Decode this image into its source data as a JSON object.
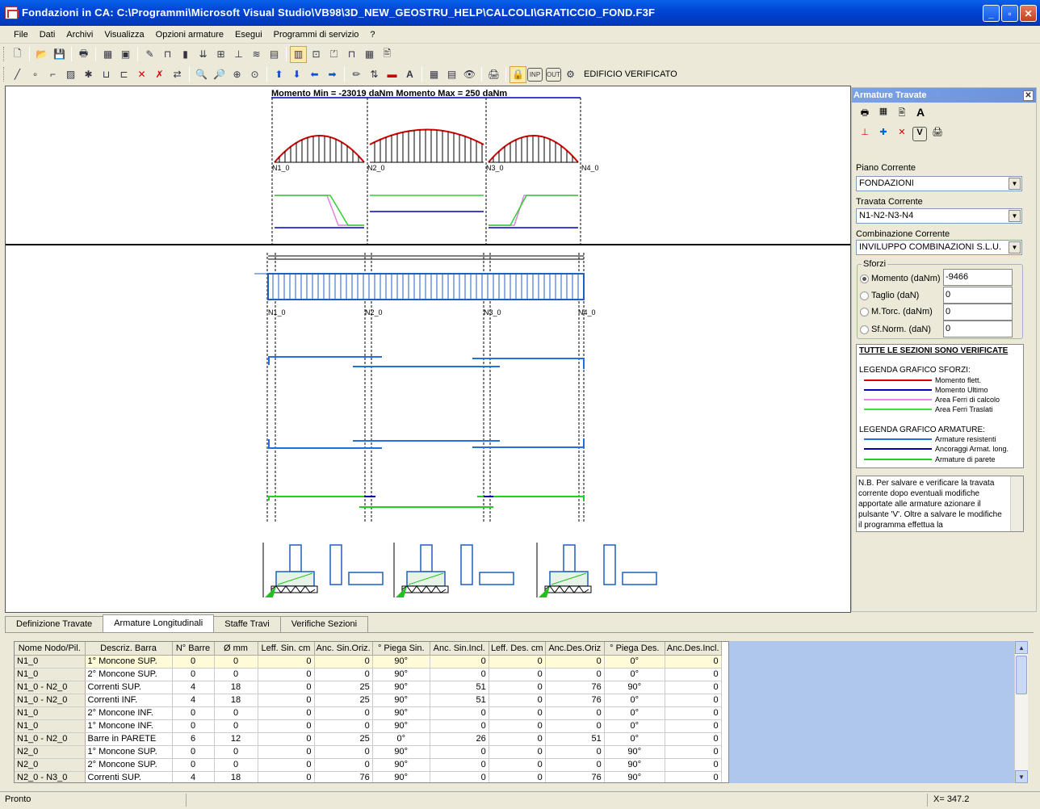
{
  "window": {
    "title": "Fondazioni in CA:    C:\\Programmi\\Microsoft Visual Studio\\VB98\\3D_NEW_GEOSTRU_HELP\\CALCOLI\\GRATICCIO_FOND.F3F"
  },
  "menu": [
    "File",
    "Dati",
    "Archivi",
    "Visualizza",
    "Opzioni armature",
    "Esegui",
    "Programmi di servizio",
    "?"
  ],
  "toolbar2": {
    "inp_label": "INP",
    "out_label": "OUT",
    "status_button": "EDIFICIO VERIFICATO"
  },
  "diagram": {
    "moment_header": "Momento Min = -23019 daNm      Momento Max = 250 daNm",
    "nodes_top": [
      "N1_0",
      "N2_0",
      "N3_0",
      "N4_0"
    ],
    "nodes_mid": [
      "N1_0",
      "N2_0",
      "N3_0",
      "N4_0"
    ]
  },
  "side": {
    "title": "Armature Travate",
    "piano_label": "Piano Corrente",
    "piano_value": "FONDAZIONI",
    "travata_label": "Travata Corrente",
    "travata_value": "N1-N2-N3-N4",
    "combinazione_label": "Combinazione Corrente",
    "combinazione_value": "INVILUPPO COMBINAZIONI  S.L.U.",
    "sforzi_label": "Sforzi",
    "sforzi": [
      {
        "label": "Momento (daNm)",
        "value": "-9466",
        "selected": true
      },
      {
        "label": "Taglio  (daN)",
        "value": "0",
        "selected": false
      },
      {
        "label": "M.Torc. (daNm)",
        "value": "0",
        "selected": false
      },
      {
        "label": "Sf.Norm.  (daN)",
        "value": "0",
        "selected": false
      }
    ],
    "verified_text": "TUTTE LE SEZIONI SONO VERIFICATE",
    "legend_sforzi_title": "LEGENDA GRAFICO SFORZI:",
    "legend_sforzi": [
      {
        "label": "Momento flett.",
        "color": "#E00000"
      },
      {
        "label": "Momento Ultimo",
        "color": "#0000C0"
      },
      {
        "label": "Area Ferri di calcolo",
        "color": "#F080F0"
      },
      {
        "label": "Area Ferri Traslati",
        "color": "#40E040"
      }
    ],
    "legend_armature_title": "LEGENDA GRAFICO ARMATURE:",
    "legend_armature": [
      {
        "label": "Armature resistenti",
        "color": "#2070E0"
      },
      {
        "label": "Ancoraggi Armat. long.",
        "color": "#0000B0"
      },
      {
        "label": "Armature di parete",
        "color": "#20D020"
      }
    ],
    "note": "N.B.   Per salvare e verificare la travata corrente dopo eventuali modifiche apportate alle armature azionare il pulsante 'V'. Oltre a salvare le modifiche il programma effettua la"
  },
  "tabs": [
    "Definizione Travate",
    "Armature Longitudinali",
    "Staffe Travi",
    "Verifiche Sezioni"
  ],
  "table": {
    "headers": [
      "Nome Nodo/Pil.",
      "Descriz. Barra",
      "N° Barre",
      "Ø  mm",
      "Leff. Sin. cm",
      "Anc. Sin.Oriz.",
      "° Piega Sin.",
      "Anc. Sin.Incl.",
      "Leff. Des. cm",
      "Anc.Des.Oriz",
      "° Piega Des.",
      "Anc.Des.Incl."
    ],
    "rows": [
      [
        "N1_0",
        "1° Moncone SUP.",
        "0",
        "0",
        "0",
        "0",
        "90°",
        "0",
        "0",
        "0",
        "0°",
        "0"
      ],
      [
        "N1_0",
        "2° Moncone SUP.",
        "0",
        "0",
        "0",
        "0",
        "90°",
        "0",
        "0",
        "0",
        "0°",
        "0"
      ],
      [
        "N1_0 - N2_0",
        "  Correnti SUP.",
        "4",
        "18",
        "0",
        "25",
        "90°",
        "51",
        "0",
        "76",
        "90°",
        "0"
      ],
      [
        "N1_0 - N2_0",
        "  Correnti  INF.",
        "4",
        "18",
        "0",
        "25",
        "90°",
        "51",
        "0",
        "76",
        "0°",
        "0"
      ],
      [
        "N1_0",
        "2° Moncone  INF.",
        "0",
        "0",
        "0",
        "0",
        "90°",
        "0",
        "0",
        "0",
        "0°",
        "0"
      ],
      [
        "N1_0",
        "1° Moncone  INF.",
        "0",
        "0",
        "0",
        "0",
        "90°",
        "0",
        "0",
        "0",
        "0°",
        "0"
      ],
      [
        "N1_0 - N2_0",
        "Barre in PARETE",
        "6",
        "12",
        "0",
        "25",
        "0°",
        "26",
        "0",
        "51",
        "0°",
        "0"
      ],
      [
        "N2_0",
        "1° Moncone SUP.",
        "0",
        "0",
        "0",
        "0",
        "90°",
        "0",
        "0",
        "0",
        "90°",
        "0"
      ],
      [
        "N2_0",
        "2° Moncone SUP.",
        "0",
        "0",
        "0",
        "0",
        "90°",
        "0",
        "0",
        "0",
        "90°",
        "0"
      ],
      [
        "N2_0 - N3_0",
        "  Correnti SUP.",
        "4",
        "18",
        "0",
        "76",
        "90°",
        "0",
        "0",
        "76",
        "90°",
        "0"
      ]
    ]
  },
  "status": {
    "left": "Pronto",
    "coord": "X=  347.2"
  }
}
